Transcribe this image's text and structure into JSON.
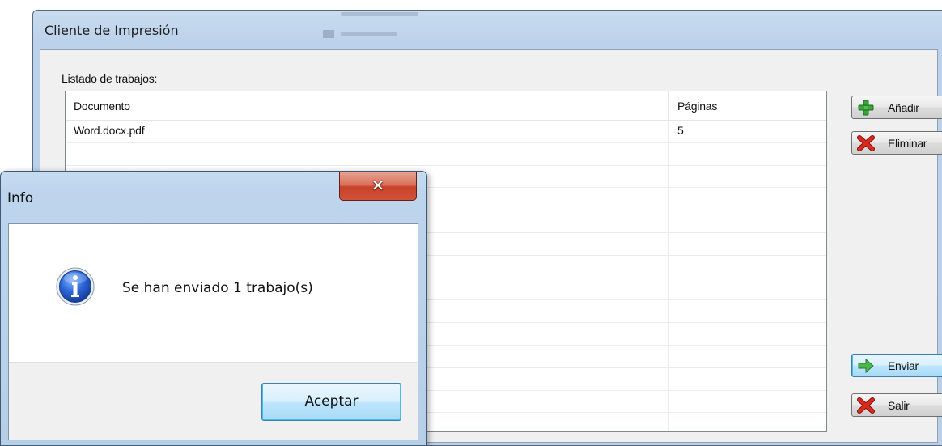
{
  "main_window": {
    "title": "Cliente de Impresión"
  },
  "jobs": {
    "label": "Listado de trabajos:",
    "columns": {
      "document": "Documento",
      "pages": "Páginas"
    },
    "rows": [
      {
        "document": "Word.docx.pdf",
        "pages": "5"
      },
      {
        "document": "",
        "pages": ""
      },
      {
        "document": "",
        "pages": ""
      },
      {
        "document": "",
        "pages": ""
      },
      {
        "document": "",
        "pages": ""
      },
      {
        "document": "",
        "pages": ""
      },
      {
        "document": "",
        "pages": ""
      },
      {
        "document": "",
        "pages": ""
      },
      {
        "document": "",
        "pages": ""
      },
      {
        "document": "",
        "pages": ""
      },
      {
        "document": "",
        "pages": ""
      },
      {
        "document": "",
        "pages": ""
      },
      {
        "document": "",
        "pages": ""
      },
      {
        "document": "",
        "pages": ""
      }
    ]
  },
  "buttons": {
    "add": {
      "label": "Añadir",
      "icon": "plus-icon"
    },
    "delete": {
      "label": "Eliminar",
      "icon": "red-x-icon"
    },
    "send": {
      "label": "Enviar",
      "icon": "green-arrow-right-icon"
    },
    "exit": {
      "label": "Salir",
      "icon": "red-x-icon"
    }
  },
  "dialog": {
    "title": "Info",
    "message": "Se han enviado 1 trabajo(s)",
    "ok_label": "Aceptar",
    "icon": "info-icon"
  },
  "colors": {
    "window_frame": "#bcd2ea",
    "client_bg": "#f0f0f0",
    "focus_blue": "#3c7fb1",
    "close_red": "#c94129"
  }
}
